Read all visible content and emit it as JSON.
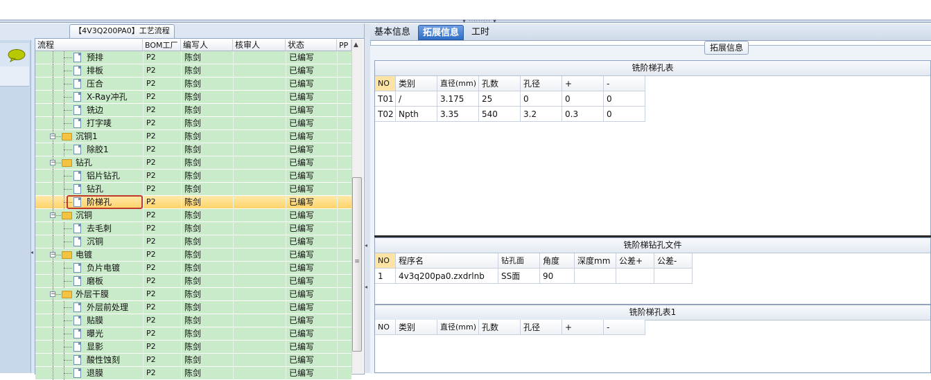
{
  "left": {
    "process_tab": "【4V3Q200PA0】工艺流程",
    "columns": [
      "流程",
      "BOM工厂",
      "编写人",
      "核审人",
      "状态",
      "PP"
    ],
    "rows": [
      {
        "name": "预排",
        "type": "doc",
        "depth": 2,
        "bom": "P2",
        "author": "陈剑",
        "status": "已编写"
      },
      {
        "name": "排板",
        "type": "doc",
        "depth": 2,
        "bom": "P2",
        "author": "陈剑",
        "status": "已编写"
      },
      {
        "name": "压合",
        "type": "doc",
        "depth": 2,
        "bom": "P2",
        "author": "陈剑",
        "status": "已编写"
      },
      {
        "name": "X-Ray冲孔",
        "type": "doc",
        "depth": 2,
        "bom": "P2",
        "author": "陈剑",
        "status": "已编写"
      },
      {
        "name": "铣边",
        "type": "doc",
        "depth": 2,
        "bom": "P2",
        "author": "陈剑",
        "status": "已编写"
      },
      {
        "name": "打字唛",
        "type": "doc",
        "depth": 2,
        "bom": "P2",
        "author": "陈剑",
        "status": "已编写"
      },
      {
        "name": "沉铜1",
        "type": "folder",
        "depth": 1,
        "bom": "P2",
        "author": "陈剑",
        "status": "已编写"
      },
      {
        "name": "除胶1",
        "type": "doc",
        "depth": 2,
        "bom": "P2",
        "author": "陈剑",
        "status": "已编写"
      },
      {
        "name": "钻孔",
        "type": "folder",
        "depth": 1,
        "bom": "P2",
        "author": "陈剑",
        "status": "已编写"
      },
      {
        "name": "铝片钻孔",
        "type": "doc",
        "depth": 2,
        "bom": "P2",
        "author": "陈剑",
        "status": "已编写"
      },
      {
        "name": "钻孔",
        "type": "doc",
        "depth": 2,
        "bom": "P2",
        "author": "陈剑",
        "status": "已编写"
      },
      {
        "name": "阶梯孔",
        "type": "doc",
        "depth": 2,
        "bom": "P2",
        "author": "陈剑",
        "status": "已编写",
        "selected": true
      },
      {
        "name": "沉铜",
        "type": "folder",
        "depth": 1,
        "bom": "P2",
        "author": "陈剑",
        "status": "已编写"
      },
      {
        "name": "去毛刺",
        "type": "doc",
        "depth": 2,
        "bom": "P2",
        "author": "陈剑",
        "status": "已编写"
      },
      {
        "name": "沉铜",
        "type": "doc",
        "depth": 2,
        "bom": "P2",
        "author": "陈剑",
        "status": "已编写"
      },
      {
        "name": "电镀",
        "type": "folder",
        "depth": 1,
        "bom": "P2",
        "author": "陈剑",
        "status": "已编写"
      },
      {
        "name": "负片电镀",
        "type": "doc",
        "depth": 2,
        "bom": "P2",
        "author": "陈剑",
        "status": "已编写"
      },
      {
        "name": "磨板",
        "type": "doc",
        "depth": 2,
        "bom": "P2",
        "author": "陈剑",
        "status": "已编写"
      },
      {
        "name": "外层干膜",
        "type": "folder",
        "depth": 1,
        "bom": "P2",
        "author": "陈剑",
        "status": "已编写"
      },
      {
        "name": "外层前处理",
        "type": "doc",
        "depth": 2,
        "bom": "P2",
        "author": "陈剑",
        "status": "已编写"
      },
      {
        "name": "贴膜",
        "type": "doc",
        "depth": 2,
        "bom": "P2",
        "author": "陈剑",
        "status": "已编写"
      },
      {
        "name": "曝光",
        "type": "doc",
        "depth": 2,
        "bom": "P2",
        "author": "陈剑",
        "status": "已编写"
      },
      {
        "name": "显影",
        "type": "doc",
        "depth": 2,
        "bom": "P2",
        "author": "陈剑",
        "status": "已编写"
      },
      {
        "name": "酸性蚀刻",
        "type": "doc",
        "depth": 2,
        "bom": "P2",
        "author": "陈剑",
        "status": "已编写"
      },
      {
        "name": "退膜",
        "type": "doc",
        "depth": 2,
        "bom": "P2",
        "author": "陈剑",
        "status": "已编写"
      }
    ]
  },
  "right": {
    "tabs": [
      "基本信息",
      "拓展信息",
      "工时"
    ],
    "active_tab": "拓展信息",
    "group_title": "拓展信息",
    "table1": {
      "title": "铣阶梯孔表",
      "headers": [
        "NO",
        "类别",
        "直径(mm)",
        "孔数",
        "孔径",
        "+",
        "-"
      ],
      "rows": [
        [
          "T01",
          "/",
          "3.175",
          "25",
          "0",
          "0",
          "0"
        ],
        [
          "T02",
          "Npth",
          "3.35",
          "540",
          "3.2",
          "0.3",
          "0"
        ]
      ]
    },
    "table2": {
      "title": "铣阶梯钻孔文件",
      "headers": [
        "NO",
        "程序名",
        "钻孔面",
        "角度",
        "深度mm",
        "公差+",
        "公差-"
      ],
      "rows": [
        [
          "1",
          "4v3q200pa0.zxdrlnb",
          "SS面",
          "90",
          "",
          "",
          ""
        ]
      ]
    },
    "table3": {
      "title": "铣阶梯孔表1",
      "headers": [
        "NO",
        "类别",
        "直径(mm)",
        "孔数",
        "孔径",
        "+",
        "-"
      ]
    }
  },
  "colors": {
    "row_green": "#c9ebc9",
    "selected_row": "#ffd36a",
    "selection_outline": "#c0392b",
    "active_tab": "#2f6fc7",
    "no_header": "#fde4a5"
  }
}
